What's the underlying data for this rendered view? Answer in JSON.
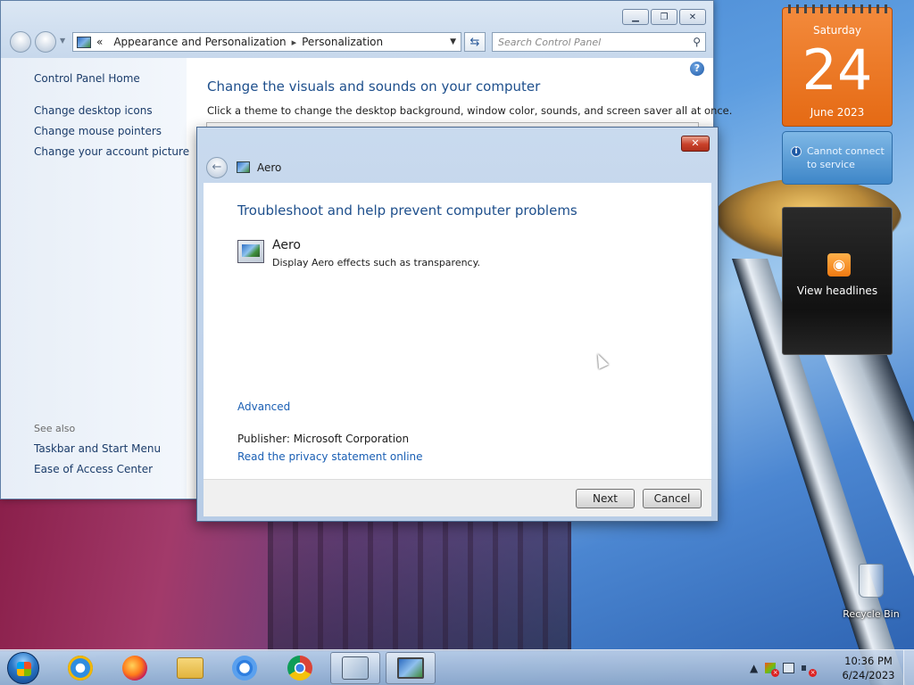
{
  "control_panel": {
    "breadcrumb": {
      "prefix": "«",
      "items": [
        "Appearance and Personalization",
        "Personalization"
      ],
      "separator": "▸"
    },
    "search_placeholder": "Search Control Panel",
    "sidebar": {
      "home": "Control Panel Home",
      "links": [
        "Change desktop icons",
        "Change mouse pointers",
        "Change your account picture"
      ],
      "see_also_label": "See also",
      "see_also": [
        "Taskbar and Start Menu",
        "Ease of Access Center"
      ]
    },
    "heading": "Change the visuals and sounds on your computer",
    "subheading": "Click a theme to change the desktop background, window color, sounds, and screen saver all at once."
  },
  "dialog": {
    "title": "Aero",
    "heading": "Troubleshoot and help prevent computer problems",
    "item": {
      "name": "Aero",
      "description": "Display Aero effects such as transparency."
    },
    "advanced_link": "Advanced",
    "publisher": "Publisher:  Microsoft Corporation",
    "privacy_link": "Read the privacy statement online",
    "buttons": {
      "next": "Next",
      "cancel": "Cancel"
    }
  },
  "gadgets": {
    "calendar": {
      "day_name": "Saturday",
      "day_number": "24",
      "month_year": "June 2023"
    },
    "weather": {
      "message_line1": "Cannot connect",
      "message_line2": "to service"
    },
    "feed": {
      "label": "View headlines"
    }
  },
  "desktop": {
    "recycle_bin_label": "Recycle Bin"
  },
  "taskbar": {
    "pinned": [
      "internet-explorer",
      "firefox",
      "file-explorer",
      "chromium",
      "chrome",
      "remote-desktop",
      "display-settings"
    ],
    "clock": {
      "time": "10:36 PM",
      "date": "6/24/2023"
    }
  },
  "colors": {
    "link": "#1a5fb4",
    "heading": "#1e4f8c",
    "calendar_orange": "#e56a14",
    "close_red": "#c9412a"
  }
}
